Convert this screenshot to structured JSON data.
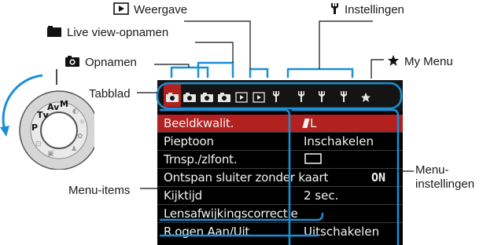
{
  "labels": {
    "weergave": "Weergave",
    "instellingen": "Instellingen",
    "live_view": "Live view-opnamen",
    "my_menu": "My Menu",
    "opnamen": "Opnamen",
    "tabblad": "Tabblad",
    "menu_items": "Menu-items",
    "menu_instellingen_1": "Menu-",
    "menu_instellingen_2": "instellingen"
  },
  "icons": {
    "weergave": "play-icon",
    "instellingen": "wrench-icon",
    "live_view": "camera-filled-icon",
    "my_menu": "star-icon",
    "opnamen": "camera-icon"
  },
  "menu": {
    "tabs": [
      {
        "icon": "camera-icon",
        "active": true
      },
      {
        "icon": "camera-icon",
        "active": false
      },
      {
        "icon": "camera-icon",
        "active": false
      },
      {
        "icon": "camera-icon",
        "active": false
      },
      {
        "icon": "play-icon",
        "active": false
      },
      {
        "icon": "play-icon",
        "active": false
      },
      {
        "icon": "wrench-icon",
        "active": false
      },
      {
        "icon": "wrench-icon",
        "active": false
      },
      {
        "icon": "wrench-icon",
        "active": false
      },
      {
        "icon": "wrench-icon",
        "active": false
      },
      {
        "icon": "star-icon",
        "active": false
      }
    ],
    "items": [
      {
        "label": "Beeldkwalit.",
        "value": "L",
        "selected": true
      },
      {
        "label": "Pieptoon",
        "value": "Inschakelen"
      },
      {
        "label": "Trnsp./zlfont.",
        "value": ""
      },
      {
        "label": "Ontspan sluiter zonder kaart",
        "value": "ON"
      },
      {
        "label": "Kijktijd",
        "value": "2 sec."
      },
      {
        "label": "Lensafwijkingscorrectie",
        "value": ""
      },
      {
        "label": "R.ogen Aan/Uit",
        "value": "Uitschakelen"
      }
    ]
  },
  "colors": {
    "accent": "#1a8fd6",
    "selected": "#b22020",
    "lcd_bg": "#000000",
    "dial_arrow": "#1a8fd6"
  }
}
